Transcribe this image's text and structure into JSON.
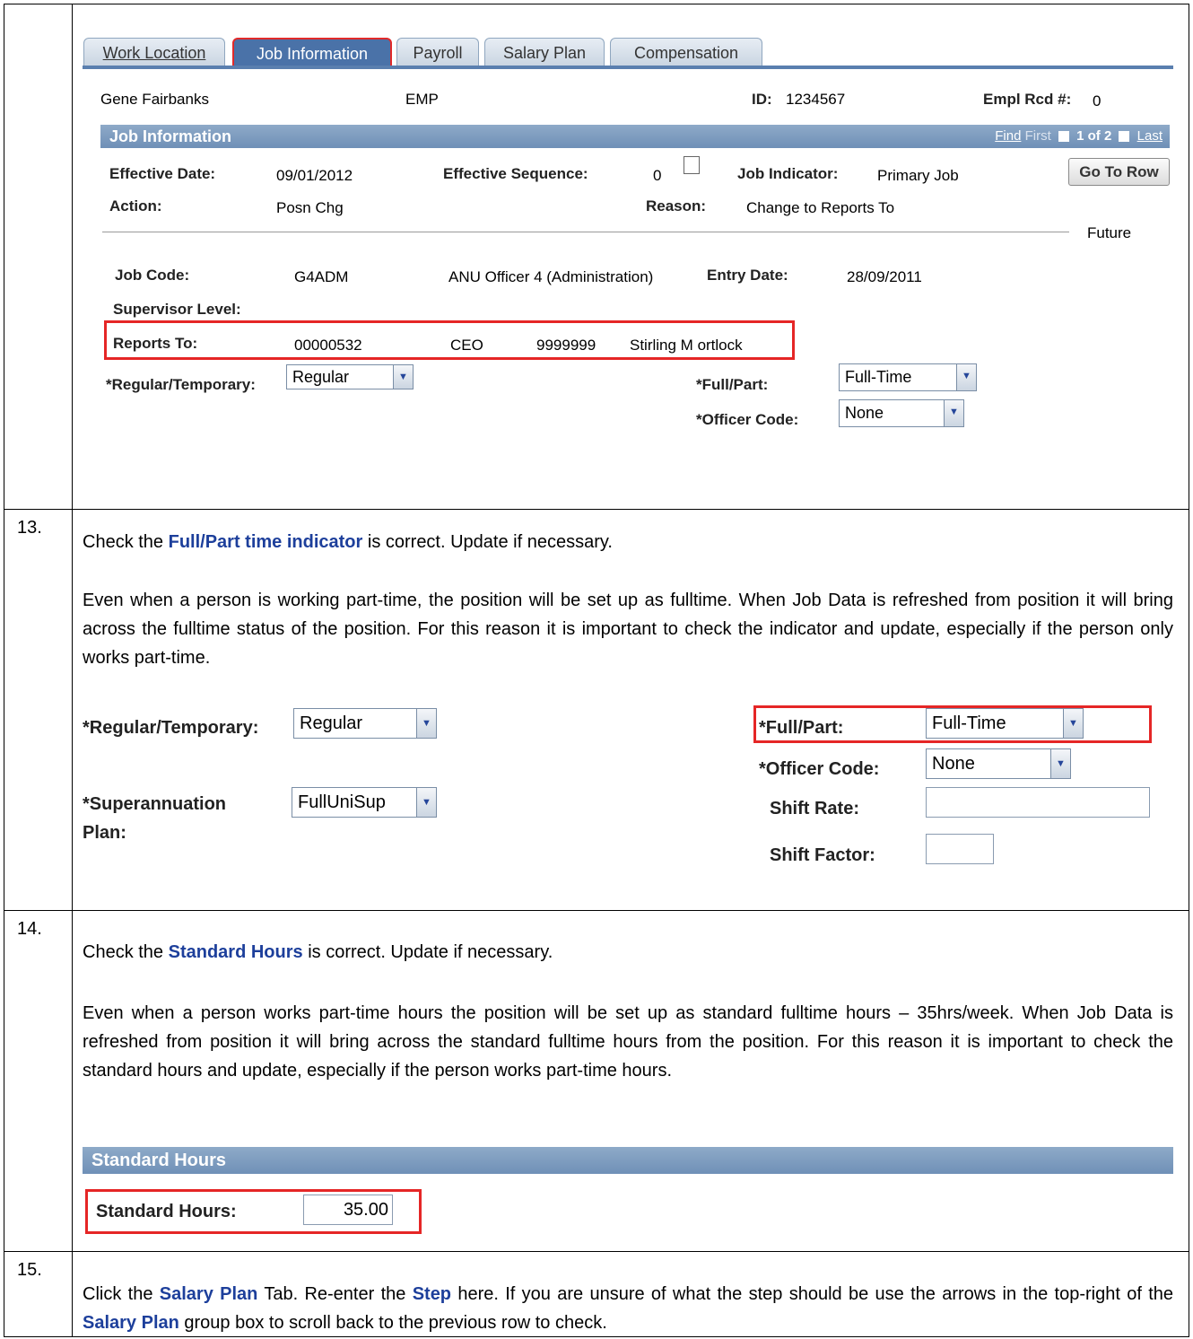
{
  "step_numbers": [
    "13.",
    "14.",
    "15."
  ],
  "job_tabs": [
    {
      "label": "Work Location"
    },
    {
      "label": "Job Information",
      "active": true
    },
    {
      "label": "Payroll"
    },
    {
      "label": "Salary Plan"
    },
    {
      "label": "Compensation"
    }
  ],
  "employee": {
    "name": "Gene Fairbanks",
    "type": "EMP",
    "id_label": "ID:",
    "id_value": "1234567",
    "empl_rcd_label": "Empl Rcd #:",
    "empl_rcd_value": "0"
  },
  "job_info": {
    "group_title": "Job Information",
    "nav": {
      "find": "Find",
      "first": "First",
      "count": "1 of 2",
      "last": "Last"
    },
    "effective_date_label": "Effective Date:",
    "effective_date": "09/01/2012",
    "effective_seq_label": "Effective Sequence:",
    "effective_seq": "0",
    "job_indicator_label": "Job Indicator:",
    "job_indicator": "Primary Job",
    "go_to_row": "Go To Row",
    "action_label": "Action:",
    "action": "Posn Chg",
    "reason_label": "Reason:",
    "reason": "Change to Reports To",
    "future": "Future",
    "job_code_label": "Job Code:",
    "job_code": "G4ADM",
    "job_code_desc": "ANU Officer 4 (Administration)",
    "entry_date_label": "Entry Date:",
    "entry_date": "28/09/2011",
    "supervisor_level_label": "Supervisor Level:",
    "reports_to_label": "Reports To:",
    "reports_to_posn": "00000532",
    "reports_to_title": "CEO",
    "reports_to_emplid": "9999999",
    "reports_to_name": "Stirling M ortlock",
    "reg_temp_label": "*Regular/Temporary:",
    "reg_temp_value": "Regular",
    "full_part_label": "*Full/Part:",
    "full_part_value": "Full-Time",
    "officer_code_label": "*Officer Code:",
    "officer_code_value": "None"
  },
  "step13": {
    "line1_pre": "Check the ",
    "line1_kw": "Full/Part time indicator",
    "line1_post": " is correct. Update if necessary.",
    "para2": "Even when a person is working part-time, the position will be set up as fulltime. When Job Data is refreshed from position it will bring across the fulltime status of the position. For this reason it is important to check the indicator and update, especially if the person only works part-time.",
    "reg_temp_label": "*Regular/Temporary:",
    "reg_temp_value": "Regular",
    "super_label_1": "*Superannuation",
    "super_label_2": "Plan:",
    "super_value": "FullUniSup",
    "full_part_label": "*Full/Part:",
    "full_part_value": "Full-Time",
    "officer_code_label": "*Officer Code:",
    "officer_code_value": "None",
    "shift_rate_label": "Shift Rate:",
    "shift_factor_label": "Shift Factor:"
  },
  "step14": {
    "line1_pre": "Check the ",
    "line1_kw": "Standard Hours",
    "line1_post": " is correct. Update if necessary.",
    "para2": "Even when a person works part-time hours the position will be set up as standard fulltime hours – 35hrs/week. When Job Data is refreshed from position it will bring across the standard fulltime hours from the position. For this reason it is important to check the standard hours and update, especially if the person works part-time hours.",
    "group_title": "Standard Hours",
    "std_hours_label": "Standard Hours:",
    "std_hours_value": "35.00"
  },
  "step15": {
    "t1": "Click the ",
    "k1": "Salary Plan",
    "t2": " Tab. Re-enter the ",
    "k2": "Step",
    "t3": " here. If you are unsure of what the step should be use the arrows in the top-right of the ",
    "k3": "Salary Plan",
    "t4": " group box to scroll back to the previous row to check."
  }
}
